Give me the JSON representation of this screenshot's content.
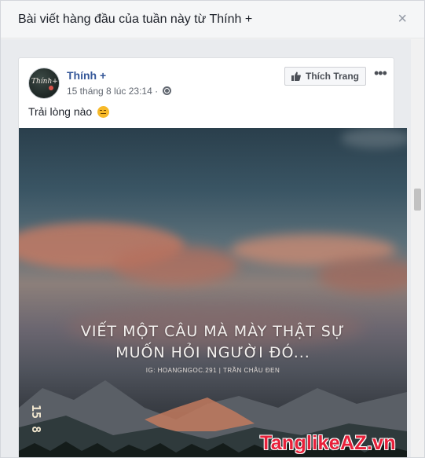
{
  "dialog": {
    "title": "Bài viết hàng đầu của tuần này từ Thính +",
    "close_label": "×"
  },
  "post": {
    "page_name": "Thính +",
    "avatar_text": "Thính+",
    "timestamp": "15 tháng 8 lúc 23:14 ·",
    "like_page_label": "Thích Trang",
    "more_label": "•••",
    "text": "Trải lòng nào",
    "image": {
      "quote_line1": "VIẾT MỘT CÂU MÀ MÀY THẬT SỰ",
      "quote_line2": "MUỐN HỎI NGƯỜI ĐÓ...",
      "credit": "IG: HOANGNGOC.291  |  TRẦN CHÂU ĐEN",
      "date_stamp": "15 8"
    }
  },
  "watermark": "TanglikeAZ.vn",
  "colors": {
    "link": "#365899",
    "watermark": "#e8203a"
  }
}
